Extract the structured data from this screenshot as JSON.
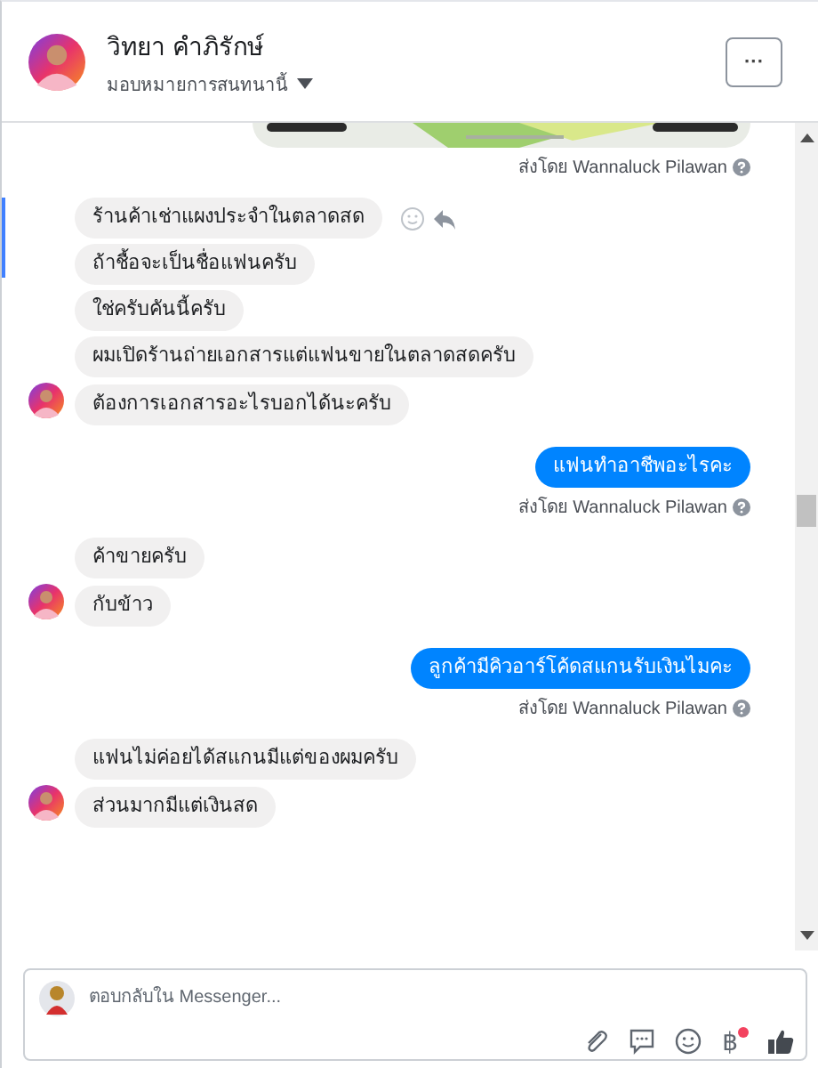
{
  "header": {
    "name": "วิทยา คำภิรักษ์",
    "subtitle": "มอบหมายการสนทนานี้",
    "more_button": "···"
  },
  "messages": [
    {
      "kind": "picture"
    },
    {
      "kind": "sent_by",
      "text": "ส่งโดย Wannaluck Pilawan"
    },
    {
      "kind": "received",
      "text": "ร้านค้าเช่าแผงประจำในตลาดสด",
      "avatar": false,
      "actions": true
    },
    {
      "kind": "received",
      "text": "ถ้าชื้อจะเป็นชื่อแฟนครับ",
      "avatar": false,
      "actions": false
    },
    {
      "kind": "received",
      "text": "ใช่ครับคันนี้ครับ",
      "avatar": false,
      "actions": false
    },
    {
      "kind": "received",
      "text": "ผมเปิดร้านถ่ายเอกสารแต่แฟนขายในตลาดสดครับ",
      "avatar": false,
      "actions": false
    },
    {
      "kind": "received",
      "text": "ต้องการเอกสารอะไรบอกได้นะครับ",
      "avatar": true,
      "actions": false
    },
    {
      "kind": "sent",
      "text": "แฟนทำอาชีพอะไรคะ"
    },
    {
      "kind": "sent_by",
      "text": "ส่งโดย Wannaluck Pilawan"
    },
    {
      "kind": "received",
      "text": "ค้าขายครับ",
      "avatar": false,
      "actions": false
    },
    {
      "kind": "received",
      "text": "กับข้าว",
      "avatar": true,
      "actions": false
    },
    {
      "kind": "sent",
      "text": "ลูกค้ามีคิวอาร์โค้ดสแกนรับเงินไมคะ"
    },
    {
      "kind": "sent_by",
      "text": "ส่งโดย Wannaluck Pilawan"
    },
    {
      "kind": "received",
      "text": "แฟนไม่ค่อยได้สแกนมีแต่ของผมครับ",
      "avatar": false,
      "actions": false
    },
    {
      "kind": "received",
      "text": "ส่วนมากมีแต่เงินสด",
      "avatar": true,
      "actions": false
    }
  ],
  "composer": {
    "placeholder": "ตอบกลับใน Messenger...",
    "currency": "฿",
    "currency_badge": true
  }
}
